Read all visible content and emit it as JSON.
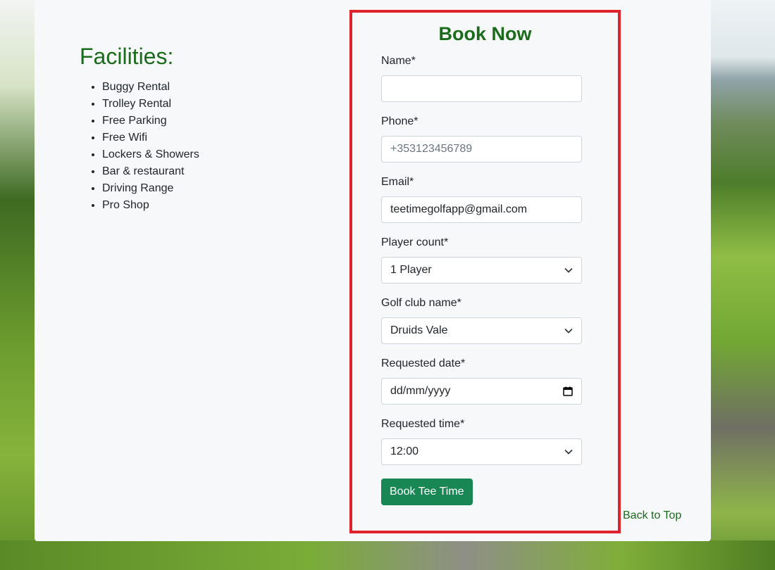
{
  "facilities": {
    "title": "Facilities:",
    "items": [
      "Buggy Rental",
      "Trolley Rental",
      "Free Parking",
      "Free Wifi",
      "Lockers & Showers",
      "Bar & restaurant",
      "Driving Range",
      "Pro Shop"
    ]
  },
  "booking": {
    "title": "Book Now",
    "name": {
      "label": "Name*",
      "value": "",
      "placeholder": ""
    },
    "phone": {
      "label": "Phone*",
      "value": "",
      "placeholder": "+353123456789"
    },
    "email": {
      "label": "Email*",
      "value": "teetimegolfapp@gmail.com",
      "placeholder": ""
    },
    "player_count": {
      "label": "Player count*",
      "value": "1 Player"
    },
    "club": {
      "label": "Golf club name*",
      "value": "Druids Vale"
    },
    "date": {
      "label": "Requested date*",
      "value": "dd/mm/yyyy"
    },
    "time": {
      "label": "Requested time*",
      "value": "12:00"
    },
    "submit_label": "Book Tee Time"
  },
  "back_to_top": "Back to Top",
  "colors": {
    "accent_green": "#1a6b1a",
    "button_green": "#198754",
    "highlight_red": "#e0222b"
  }
}
